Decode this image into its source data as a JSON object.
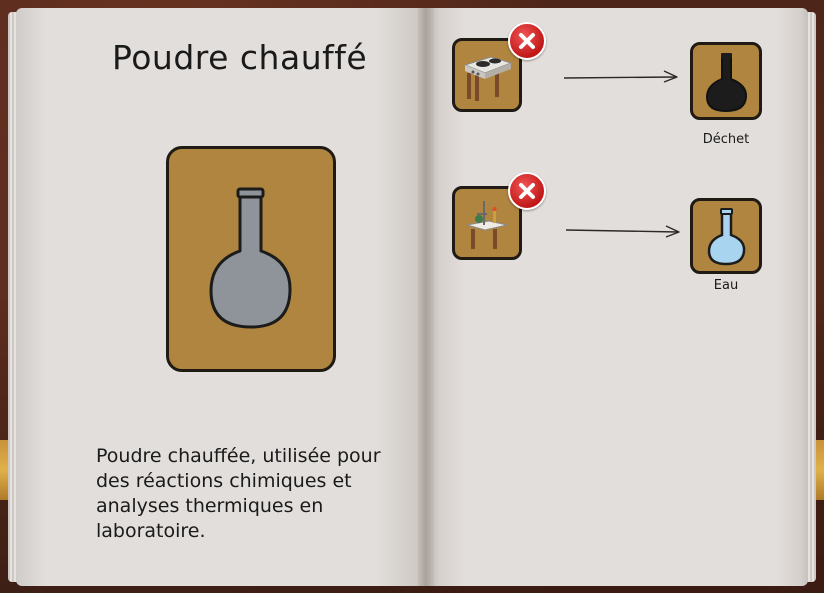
{
  "recipe": {
    "title": "Poudre chauffé",
    "description": "Poudre chauffée, utilisée pour des réactions chimiques et analyses thermiques en laboratoire."
  },
  "conversions": [
    {
      "station_icon": "hot-plate-icon",
      "status": "unavailable",
      "result_label": "Déchet",
      "result_icon": "black-flask-icon"
    },
    {
      "station_icon": "lab-bench-icon",
      "status": "unavailable",
      "result_label": "Eau",
      "result_icon": "light-blue-flask-icon"
    }
  ],
  "colors": {
    "card": "#b0853f",
    "page": "#e2dedb",
    "item_flask": "#8e949a",
    "waste_flask": "#1c1c1c",
    "water_flask": "#a9d4ef",
    "unavailable_badge": "#d42020"
  }
}
